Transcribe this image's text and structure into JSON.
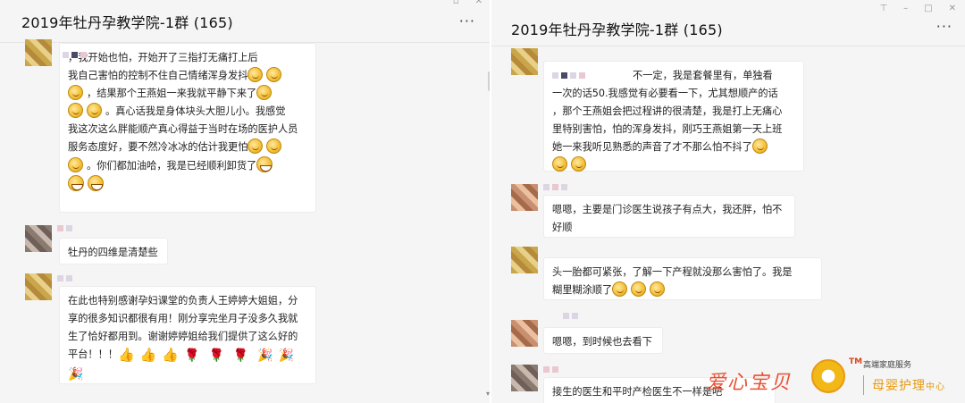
{
  "left": {
    "title": "2019年牡丹孕教学院-1群 (165)",
    "more": "···",
    "win_controls": [
      "‾",
      "▫",
      "✕"
    ],
    "messages": [
      {
        "lines": [
          "，我开始也怕，开始开了三指打无痛打上后",
          "我自己害怕的控制不住自己情绪浑身发抖"
        ],
        "l3": "，结果那个王燕姐一来我就平静下来了",
        "l4": "。真心话我是身体块头大胆儿小。我感觉",
        "l5": "我这次这么胖能顺产真心得益于当时在场的医护人员",
        "l6": "服务态度好，要不然冷冰冰的估计我更怕",
        "l7": "。你们都加油哈，我是已经顺利卸货了"
      },
      {
        "text": "牡丹的四维是清楚些"
      },
      {
        "l1": "在此也特别感谢孕妇课堂的负责人王婷婷大姐姐，分",
        "l2": "享的很多知识都很有用！刚分享完坐月子没多久我就",
        "l3": "生了恰好都用到。谢谢婷婷姐给我们提供了这么好的",
        "l4": "平台！！！"
      }
    ]
  },
  "right": {
    "title": "2019年牡丹孕教学院-1群 (165)",
    "more": "···",
    "win_controls": [
      "⊤",
      "–",
      "□",
      "✕"
    ],
    "messages": [
      {
        "l1": "不一定，我是套餐里有，单独看",
        "l2": "一次的话50.我感觉有必要看一下，尤其想顺产的话",
        "l3": "，那个王燕姐会把过程讲的很清楚，我是打上无痛心",
        "l4": "里特别害怕，怕的浑身发抖，刚巧王燕姐第一天上班",
        "l5": "她一来我听见熟悉的声音了才不那么怕不抖了"
      },
      {
        "l1": "嗯嗯，主要是门诊医生说孩子有点大，我还胖，怕不",
        "l2": "好顺"
      },
      {
        "l1": "头一胎都可紧张，了解一下产程就没那么害怕了。我是",
        "l2": "糊里糊涂顺了"
      },
      {
        "text": "嗯嗯，到时候也去看下"
      },
      {
        "text": "接生的医生和平时产检医生不一样是吧"
      }
    ]
  },
  "watermark": {
    "text": "爱心宝贝",
    "tm": "TM",
    "service": "高端家庭服务",
    "brand": "母婴护理",
    "center": "中心"
  },
  "colors": {
    "window_bg": "#f5f5f5",
    "bubble_bg": "#ffffff",
    "watermark_red": "#e84a2a",
    "watermark_gold": "#e89a10"
  }
}
